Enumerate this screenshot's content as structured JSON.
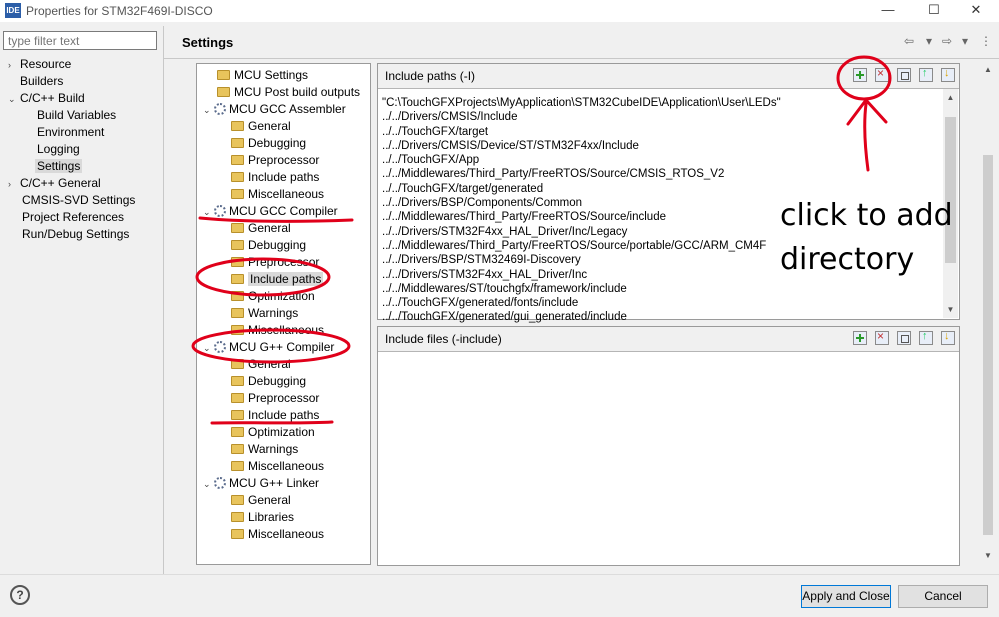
{
  "window": {
    "app_icon": "IDE",
    "title": "Properties for STM32F469I-DISCO",
    "minimize": "—",
    "maximize": "☐",
    "close": "✕"
  },
  "filter": {
    "placeholder": "type filter text"
  },
  "sidebar": {
    "items": [
      {
        "label": "Resource",
        "twisty": "›"
      },
      {
        "label": "Builders",
        "twisty": ""
      },
      {
        "label": "C/C++ Build",
        "twisty": "⌄"
      },
      {
        "label": "Build Variables",
        "twisty": ""
      },
      {
        "label": "Environment",
        "twisty": ""
      },
      {
        "label": "Logging",
        "twisty": ""
      },
      {
        "label": "Settings",
        "twisty": ""
      },
      {
        "label": "C/C++ General",
        "twisty": "›"
      },
      {
        "label": "CMSIS-SVD Settings",
        "twisty": ""
      },
      {
        "label": "Project References",
        "twisty": ""
      },
      {
        "label": "Run/Debug Settings",
        "twisty": ""
      }
    ]
  },
  "header": {
    "title": "Settings",
    "back_icon": "⇦",
    "dropdown_icon": "▾",
    "forward_icon": "⇨",
    "menu_icon": "⋮"
  },
  "tool_tree": {
    "items": [
      {
        "label": "MCU Settings",
        "kind": "folder"
      },
      {
        "label": "MCU Post build outputs",
        "kind": "folder"
      },
      {
        "label": "MCU GCC Assembler",
        "kind": "gear",
        "twisty": "⌄"
      },
      {
        "label": "General",
        "kind": "folder"
      },
      {
        "label": "Debugging",
        "kind": "folder"
      },
      {
        "label": "Preprocessor",
        "kind": "folder"
      },
      {
        "label": "Include paths",
        "kind": "folder"
      },
      {
        "label": "Miscellaneous",
        "kind": "folder"
      },
      {
        "label": "MCU GCC Compiler",
        "kind": "gear",
        "twisty": "⌄"
      },
      {
        "label": "General",
        "kind": "folder"
      },
      {
        "label": "Debugging",
        "kind": "folder"
      },
      {
        "label": "Preprocessor",
        "kind": "folder"
      },
      {
        "label": "Include paths",
        "kind": "folder"
      },
      {
        "label": "Optimization",
        "kind": "folder"
      },
      {
        "label": "Warnings",
        "kind": "folder"
      },
      {
        "label": "Miscellaneous",
        "kind": "folder"
      },
      {
        "label": "MCU G++ Compiler",
        "kind": "gear",
        "twisty": "⌄"
      },
      {
        "label": "General",
        "kind": "folder"
      },
      {
        "label": "Debugging",
        "kind": "folder"
      },
      {
        "label": "Preprocessor",
        "kind": "folder"
      },
      {
        "label": "Include paths",
        "kind": "folder"
      },
      {
        "label": "Optimization",
        "kind": "folder"
      },
      {
        "label": "Warnings",
        "kind": "folder"
      },
      {
        "label": "Miscellaneous",
        "kind": "folder"
      },
      {
        "label": "MCU G++ Linker",
        "kind": "gear",
        "twisty": "⌄"
      },
      {
        "label": "General",
        "kind": "folder"
      },
      {
        "label": "Libraries",
        "kind": "folder"
      },
      {
        "label": "Miscellaneous",
        "kind": "folder"
      }
    ]
  },
  "include_paths": {
    "title": "Include paths (-I)",
    "paths": [
      "\"C:\\TouchGFXProjects\\MyApplication\\STM32CubeIDE\\Application\\User\\LEDs\"",
      "../../Drivers/CMSIS/Include",
      "../../TouchGFX/target",
      "../../Drivers/CMSIS/Device/ST/STM32F4xx/Include",
      "../../TouchGFX/App",
      "../../Middlewares/Third_Party/FreeRTOS/Source/CMSIS_RTOS_V2",
      "../../TouchGFX/target/generated",
      "../../Drivers/BSP/Components/Common",
      "../../Middlewares/Third_Party/FreeRTOS/Source/include",
      "../../Drivers/STM32F4xx_HAL_Driver/Inc/Legacy",
      "../../Middlewares/Third_Party/FreeRTOS/Source/portable/GCC/ARM_CM4F",
      "../../Drivers/BSP/STM32469I-Discovery",
      "../../Drivers/STM32F4xx_HAL_Driver/Inc",
      "../../Middlewares/ST/touchgfx/framework/include",
      "../../TouchGFX/generated/fonts/include",
      "../../TouchGFX/generated/gui_generated/include"
    ]
  },
  "include_files": {
    "title": "Include files (-include)"
  },
  "annotation": {
    "line1": "click to add",
    "line2": "directory"
  },
  "footer": {
    "help_icon": "?",
    "apply_label": "Apply and Close",
    "cancel_label": "Cancel"
  },
  "colors": {
    "annotation_red": "#e0001a",
    "selection": "#d9d9d9"
  },
  "icons": [
    "app-icon",
    "back-icon",
    "forward-icon",
    "menu-icon",
    "add-icon",
    "delete-icon",
    "edit-icon",
    "move-up-icon",
    "move-down-icon",
    "folder-icon",
    "gear-icon",
    "help-icon"
  ]
}
